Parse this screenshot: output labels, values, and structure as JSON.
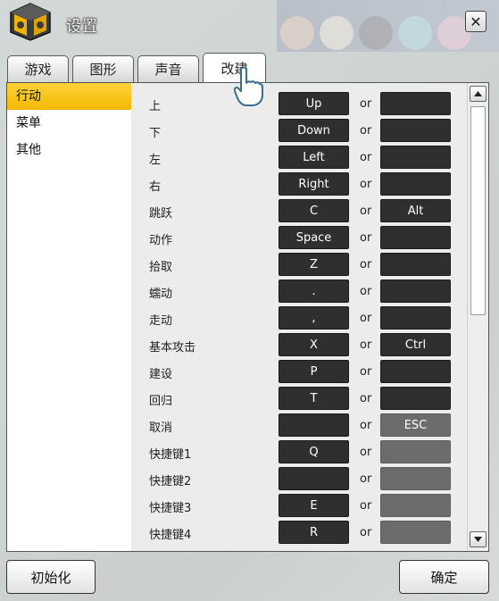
{
  "window": {
    "title": "设置"
  },
  "tabs": [
    {
      "label": "游戏",
      "active": false
    },
    {
      "label": "图形",
      "active": false
    },
    {
      "label": "声音",
      "active": false
    },
    {
      "label": "改建",
      "active": true
    }
  ],
  "sidebar": {
    "items": [
      {
        "label": "行动",
        "active": true
      },
      {
        "label": "菜单",
        "active": false
      },
      {
        "label": "其他",
        "active": false
      }
    ]
  },
  "separator": "or",
  "keybindings": [
    {
      "action": "上",
      "primary": "Up",
      "secondary": ""
    },
    {
      "action": "下",
      "primary": "Down",
      "secondary": ""
    },
    {
      "action": "左",
      "primary": "Left",
      "secondary": ""
    },
    {
      "action": "右",
      "primary": "Right",
      "secondary": ""
    },
    {
      "action": "跳跃",
      "primary": "C",
      "secondary": "Alt"
    },
    {
      "action": "动作",
      "primary": "Space",
      "secondary": ""
    },
    {
      "action": "拾取",
      "primary": "Z",
      "secondary": ""
    },
    {
      "action": "蠕动",
      "primary": ".",
      "secondary": ""
    },
    {
      "action": "走动",
      "primary": ",",
      "secondary": ""
    },
    {
      "action": "基本攻击",
      "primary": "X",
      "secondary": "Ctrl"
    },
    {
      "action": "建设",
      "primary": "P",
      "secondary": ""
    },
    {
      "action": "回归",
      "primary": "T",
      "secondary": ""
    },
    {
      "action": "取消",
      "primary": "",
      "secondary": "ESC",
      "secondary_disabled": true
    },
    {
      "action": "快捷键1",
      "primary": "Q",
      "secondary": "",
      "secondary_disabled": true
    },
    {
      "action": "快捷键2",
      "primary": "",
      "secondary": "",
      "secondary_disabled": true
    },
    {
      "action": "快捷键3",
      "primary": "E",
      "secondary": "",
      "secondary_disabled": true
    },
    {
      "action": "快捷键4",
      "primary": "R",
      "secondary": "",
      "secondary_disabled": true
    }
  ],
  "footer": {
    "reset_label": "初始化",
    "confirm_label": "确定"
  },
  "icons": {
    "app": "gear-box-icon",
    "close": "close-icon",
    "scroll_up": "scroll-up-arrow-icon",
    "scroll_down": "scroll-down-arrow-icon",
    "pointer": "hand-pointer-icon"
  },
  "colors": {
    "active_sidebar": "#f5b800",
    "key_background": "#2f2f2f",
    "key_disabled": "#6c6c6c"
  }
}
